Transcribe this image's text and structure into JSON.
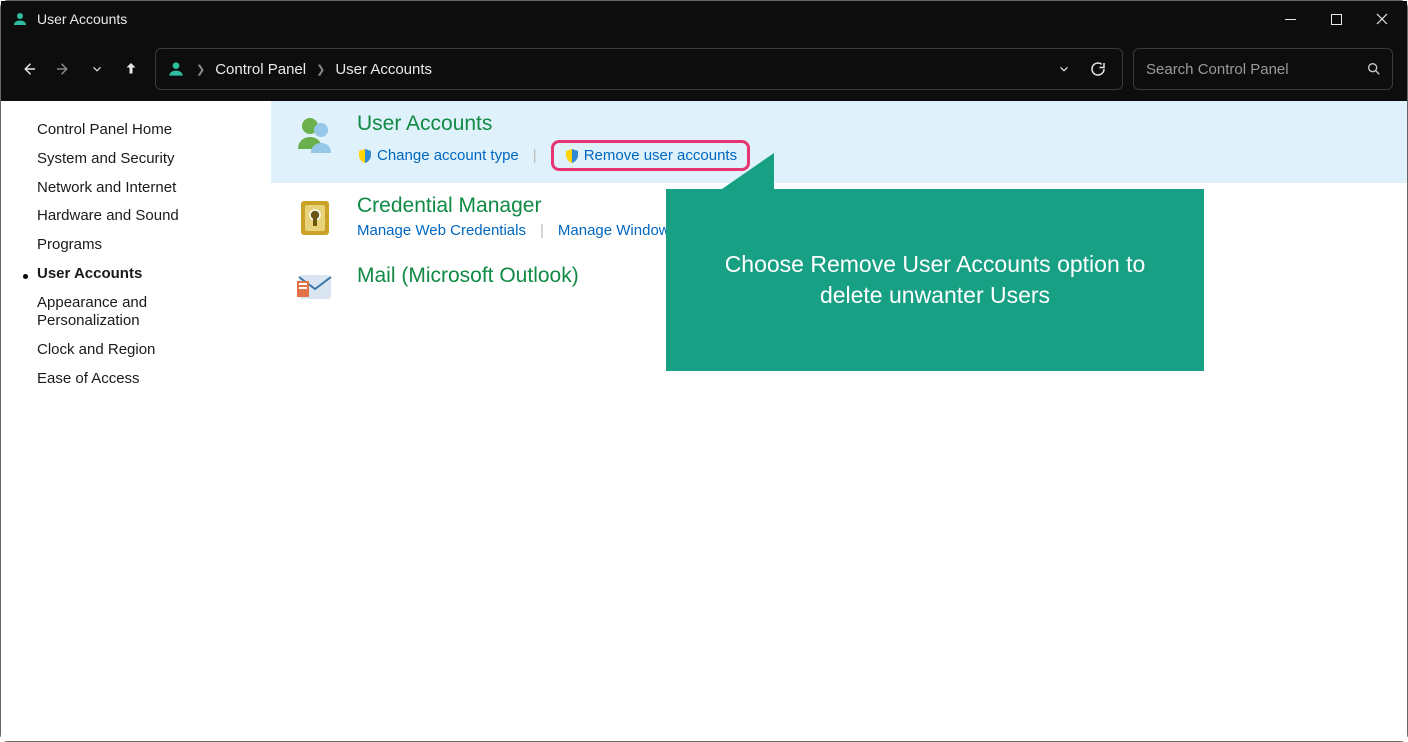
{
  "window": {
    "title": "User Accounts"
  },
  "breadcrumb": {
    "root": "Control Panel",
    "current": "User Accounts"
  },
  "search": {
    "placeholder": "Search Control Panel"
  },
  "sidebar": {
    "home": "Control Panel Home",
    "items": [
      "System and Security",
      "Network and Internet",
      "Hardware and Sound",
      "Programs",
      "User Accounts",
      "Appearance and Personalization",
      "Clock and Region",
      "Ease of Access"
    ],
    "active_index": 4
  },
  "sections": {
    "user_accounts": {
      "title": "User Accounts",
      "links": [
        "Change account type",
        "Remove user accounts"
      ]
    },
    "credential_manager": {
      "title": "Credential Manager",
      "links": [
        "Manage Web Credentials",
        "Manage Windows Credentials"
      ]
    },
    "mail": {
      "title": "Mail (Microsoft Outlook)"
    }
  },
  "callout": {
    "text": "Choose Remove User Accounts option to delete unwanter Users"
  }
}
